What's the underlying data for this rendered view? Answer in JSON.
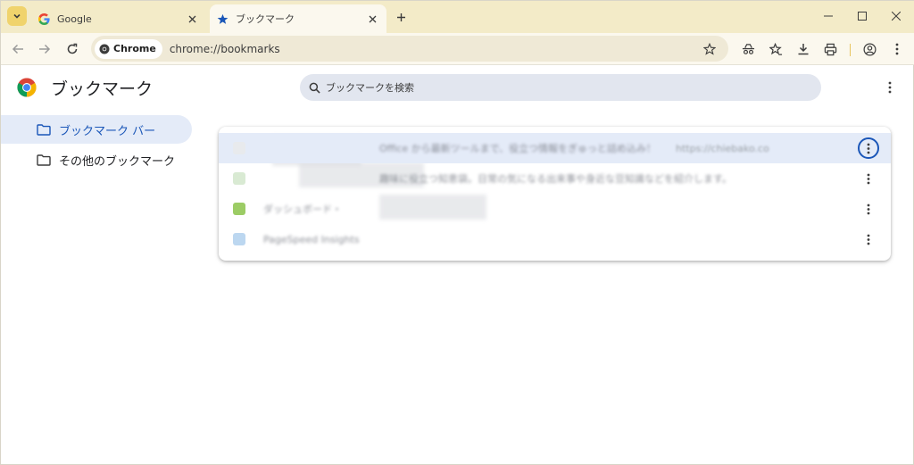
{
  "browser": {
    "tabs": [
      {
        "title": "Google",
        "active": false
      },
      {
        "title": "ブックマーク",
        "active": true
      }
    ],
    "omnibox": {
      "chip_label": "Chrome",
      "url": "chrome://bookmarks"
    }
  },
  "page": {
    "title": "ブックマーク",
    "search": {
      "placeholder": "ブックマークを検索"
    }
  },
  "sidebar": {
    "items": [
      {
        "label": "ブックマーク バー",
        "selected": true
      },
      {
        "label": "その他のブックマーク",
        "selected": false
      }
    ]
  },
  "bookmarks": [
    {
      "title": "Office から最新ツールまで、役立つ情報をぎゅっと詰め込み！",
      "url": "https://chiebako.co"
    },
    {
      "title": "趣味に役立つ知恵袋。日常の気になる出来事や身近な豆知識などを紹介します。",
      "url": ""
    },
    {
      "title": "ダッシュボード・",
      "url": ""
    },
    {
      "title": "PageSpeed Insights",
      "url": ""
    }
  ],
  "colors": {
    "tabstrip": "#f3ebc8",
    "toolbar": "#fbf8ee",
    "accent": "#1a56b8",
    "selected_bg": "#e4ebf8"
  }
}
